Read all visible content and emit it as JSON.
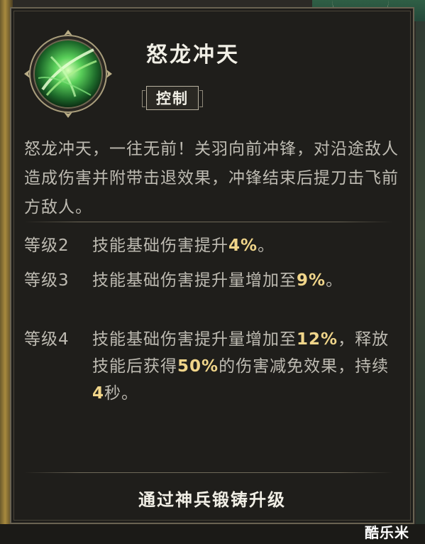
{
  "skill": {
    "name": "怒龙冲天",
    "tag": "控制",
    "description": "怒龙冲天，一往无前！关羽向前冲锋，对沿途敌人造成伤害并附带击退效果，冲锋结束后提刀击飞前方敌人。"
  },
  "levels": [
    {
      "label": "等级2",
      "parts": [
        {
          "text": "技能基础伤害提升",
          "hl": false
        },
        {
          "text": "4%",
          "hl": true
        },
        {
          "text": "。",
          "hl": false
        }
      ]
    },
    {
      "label": "等级3",
      "parts": [
        {
          "text": "技能基础伤害提升量增加至",
          "hl": false
        },
        {
          "text": "9%",
          "hl": true
        },
        {
          "text": "。",
          "hl": false
        }
      ]
    },
    {
      "label": "等级4",
      "parts": [
        {
          "text": "技能基础伤害提升量增加至",
          "hl": false
        },
        {
          "text": "12%",
          "hl": true
        },
        {
          "text": "，释放技能后获得",
          "hl": false
        },
        {
          "text": "50%",
          "hl": true
        },
        {
          "text": "的伤害减免效果，持续",
          "hl": false
        },
        {
          "text": "4",
          "hl": true
        },
        {
          "text": "秒。",
          "hl": false
        }
      ]
    }
  ],
  "footer": {
    "upgrade_hint": "通过神兵锻铸升级"
  },
  "watermark": "酷乐米",
  "colors": {
    "highlight": "#f0d58a",
    "text": "#bebbb2",
    "title": "#f1efe6",
    "panel": "#1f1e1b",
    "emblem_green": "#5ad05a"
  },
  "icons": {
    "skill_emblem": "green-dragon-charge-icon"
  }
}
